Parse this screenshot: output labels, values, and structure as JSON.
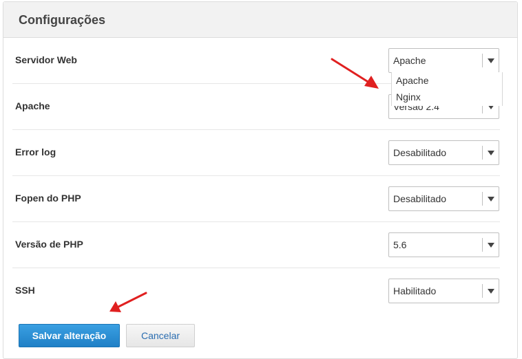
{
  "panel": {
    "title": "Configurações"
  },
  "settings": [
    {
      "label": "Servidor Web",
      "value": "Apache"
    },
    {
      "label": "Apache",
      "value": "Versão 2.4"
    },
    {
      "label": "Error log",
      "value": "Desabilitado"
    },
    {
      "label": "Fopen do PHP",
      "value": "Desabilitado"
    },
    {
      "label": "Versão de PHP",
      "value": "5.6"
    },
    {
      "label": "SSH",
      "value": "Habilitado"
    }
  ],
  "dropdown_options": [
    "Apache",
    "Nginx"
  ],
  "actions": {
    "save_label": "Salvar alteração",
    "cancel_label": "Cancelar"
  },
  "colors": {
    "annotation_arrow": "#e02020",
    "primary_button": "#2a8fd6",
    "link_text": "#2a6db0"
  }
}
